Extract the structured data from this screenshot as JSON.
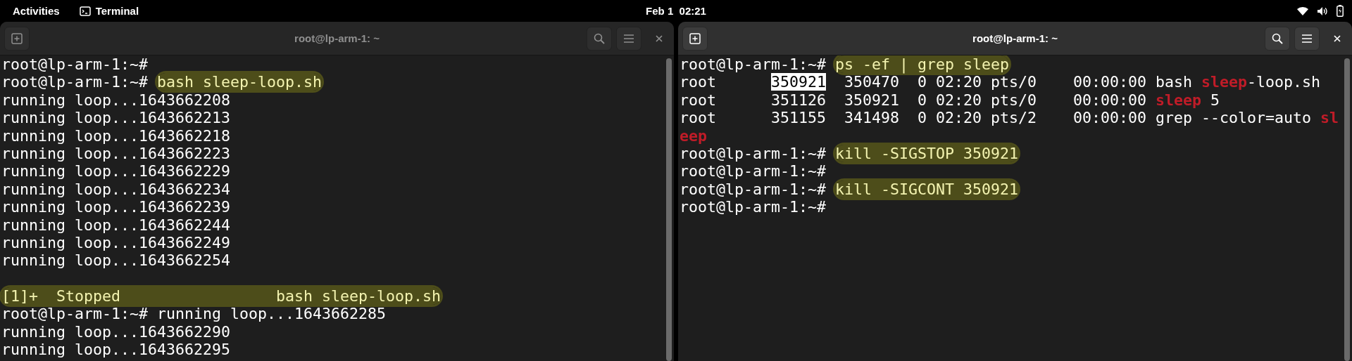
{
  "top_bar": {
    "activities": "Activities",
    "app": "Terminal",
    "clock": "Feb 1  02:21"
  },
  "terminals": [
    {
      "title": "root@lp-arm-1: ~",
      "active": false,
      "lines": [
        [
          {
            "text": "root@lp-arm-1:~#",
            "kind": "plain"
          }
        ],
        [
          {
            "text": "root@lp-arm-1:~# ",
            "kind": "plain"
          },
          {
            "text": "bash sleep-loop.sh",
            "kind": "marked"
          }
        ],
        [
          {
            "text": "running loop...1643662208",
            "kind": "plain"
          }
        ],
        [
          {
            "text": "running loop...1643662213",
            "kind": "plain"
          }
        ],
        [
          {
            "text": "running loop...1643662218",
            "kind": "plain"
          }
        ],
        [
          {
            "text": "running loop...1643662223",
            "kind": "plain"
          }
        ],
        [
          {
            "text": "running loop...1643662229",
            "kind": "plain"
          }
        ],
        [
          {
            "text": "running loop...1643662234",
            "kind": "plain"
          }
        ],
        [
          {
            "text": "running loop...1643662239",
            "kind": "plain"
          }
        ],
        [
          {
            "text": "running loop...1643662244",
            "kind": "plain"
          }
        ],
        [
          {
            "text": "running loop...1643662249",
            "kind": "plain"
          }
        ],
        [
          {
            "text": "running loop...1643662254",
            "kind": "plain"
          }
        ],
        [
          {
            "text": "[1]+  Stopped                 bash sleep-loop.sh",
            "kind": "marked",
            "gap_before": true
          }
        ],
        [
          {
            "text": "root@lp-arm-1:~# running loop...1643662285",
            "kind": "plain"
          }
        ],
        [
          {
            "text": "running loop...1643662290",
            "kind": "plain"
          }
        ],
        [
          {
            "text": "running loop...1643662295",
            "kind": "plain"
          }
        ]
      ]
    },
    {
      "title": "root@lp-arm-1: ~",
      "active": true,
      "lines": [
        [
          {
            "text": "root@lp-arm-1:~# ",
            "kind": "plain"
          },
          {
            "text": "ps -ef | grep sleep",
            "kind": "marked"
          }
        ],
        [
          {
            "text": "root      ",
            "kind": "plain"
          },
          {
            "text": "350921",
            "kind": "selected"
          },
          {
            "text": "  350470  0 02:20 pts/0    00:00:00 bash ",
            "kind": "plain"
          },
          {
            "text": "sleep",
            "kind": "match"
          },
          {
            "text": "-loop.sh",
            "kind": "plain"
          }
        ],
        [
          {
            "text": "root      351126  350921  0 02:20 pts/0    00:00:00 ",
            "kind": "plain"
          },
          {
            "text": "sleep",
            "kind": "match"
          },
          {
            "text": " 5",
            "kind": "plain"
          }
        ],
        [
          {
            "text": "root      351155  341498  0 02:20 pts/2    00:00:00 grep --color=auto ",
            "kind": "plain"
          },
          {
            "text": "sl",
            "kind": "match"
          }
        ],
        [
          {
            "text": "eep",
            "kind": "match"
          }
        ],
        [
          {
            "text": "root@lp-arm-1:~# ",
            "kind": "plain"
          },
          {
            "text": "kill -SIGSTOP 350921",
            "kind": "marked"
          }
        ],
        [
          {
            "text": "root@lp-arm-1:~#",
            "kind": "plain"
          }
        ],
        [
          {
            "text": "root@lp-arm-1:~# ",
            "kind": "plain"
          },
          {
            "text": "kill -SIGCONT 350921",
            "kind": "marked"
          }
        ],
        [
          {
            "text": "root@lp-arm-1:~#",
            "kind": "plain"
          }
        ]
      ]
    }
  ]
}
